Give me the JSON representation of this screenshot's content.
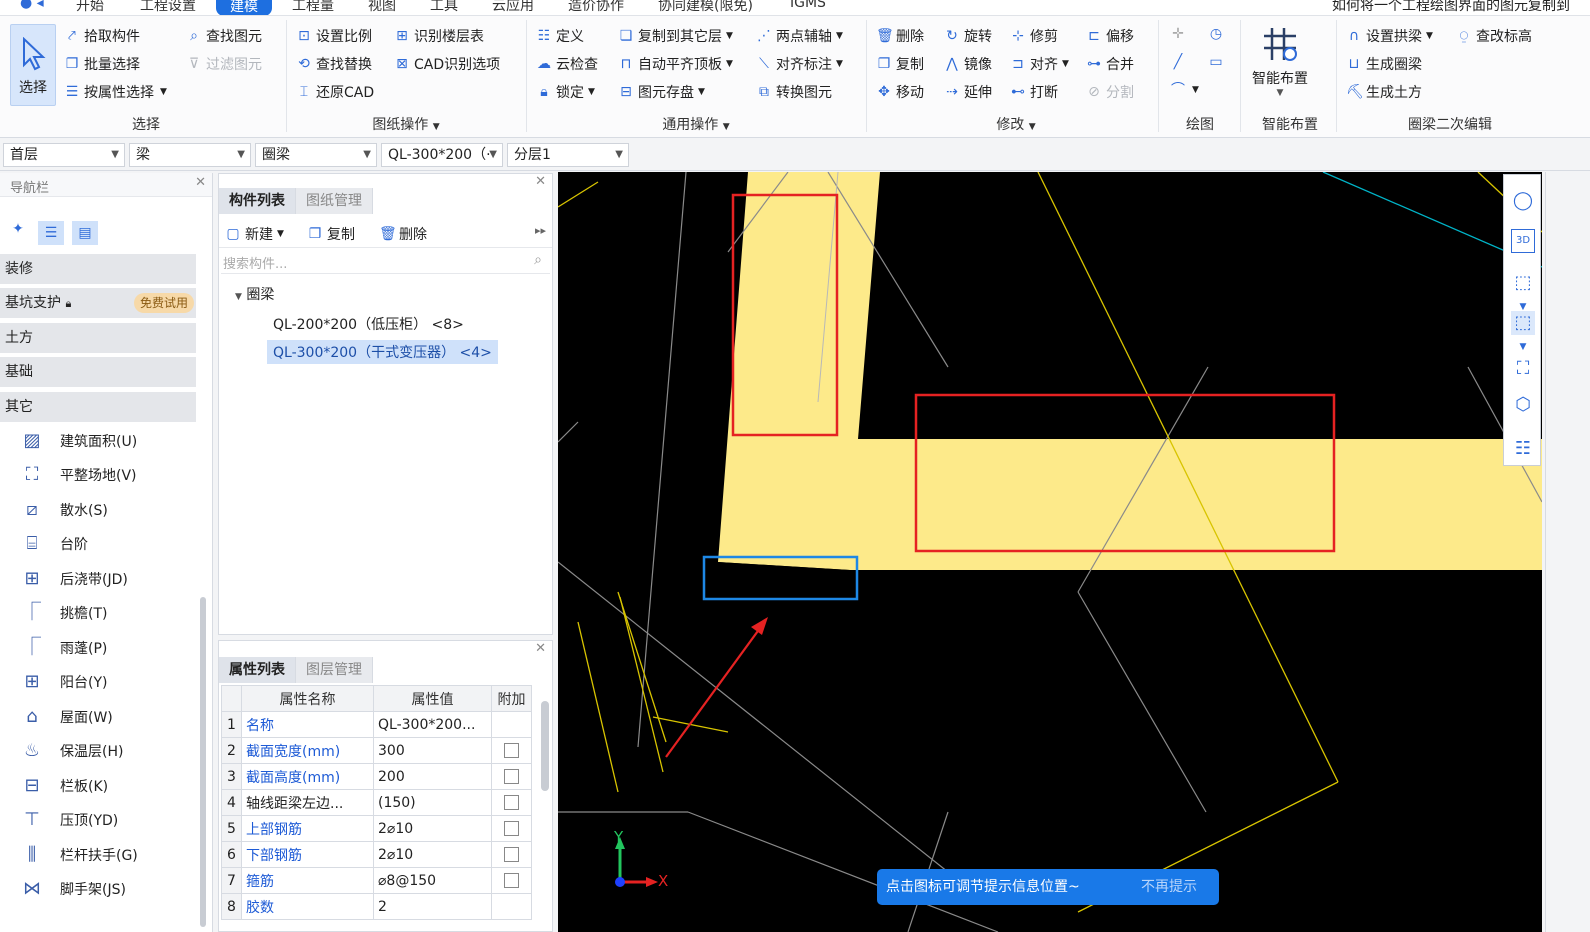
{
  "menu": {
    "items": [
      "开始",
      "工程设置",
      "建模",
      "工程量",
      "视图",
      "工具",
      "云应用",
      "造价协作",
      "协同建模(限免)",
      "IGMS"
    ],
    "active": "建模",
    "question": "如何将一个工程绘图界面的图元复制到"
  },
  "ribbon": {
    "select_big": "选择",
    "select_group": {
      "pick": "拾取构件",
      "batch": "批量选择",
      "byprop": "按属性选择",
      "find": "查找图元",
      "filter": "过滤图元",
      "label": "选择"
    },
    "drawing_group": {
      "scale": "设置比例",
      "identify_floor": "识别楼层表",
      "find_replace": "查找替换",
      "cad_options": "CAD识别选项",
      "restore": "还原CAD",
      "label": "图纸操作"
    },
    "common_group": {
      "define": "定义",
      "copy_to_layer": "复制到其它层",
      "two_point_axis": "两点辅轴",
      "cloud_check": "云检查",
      "auto_align": "自动平齐顶板",
      "align_mark": "对齐标注",
      "lock": "锁定",
      "element_store": "图元存盘",
      "convert": "转换图元",
      "label": "通用操作"
    },
    "modify_group": {
      "delete": "删除",
      "rotate": "旋转",
      "trim": "修剪",
      "offset": "偏移",
      "copy": "复制",
      "mirror": "镜像",
      "align": "对齐",
      "merge": "合并",
      "move": "移动",
      "extend": "延伸",
      "break": "打断",
      "split": "分割",
      "label": "修改"
    },
    "draw_label": "绘图",
    "smart": {
      "button": "智能布置",
      "label": "智能布置"
    },
    "ring_group": {
      "set_arch": "设置拱梁",
      "check_elev": "查改标高",
      "gen_ring": "生成圈梁",
      "gen_earth": "生成土方",
      "label": "圈梁二次编辑"
    }
  },
  "combos": {
    "floor": "首层",
    "type": "梁",
    "subtype": "圈梁",
    "element": "QL-300*200（·",
    "layer": "分层1"
  },
  "nav": {
    "title": "导航栏",
    "categories": [
      "装修",
      "基坑支护",
      "土方",
      "基础",
      "其它"
    ],
    "trial_badge": "免费试用",
    "items": [
      "建筑面积(U)",
      "平整场地(V)",
      "散水(S)",
      "台阶",
      "后浇带(JD)",
      "挑檐(T)",
      "雨蓬(P)",
      "阳台(Y)",
      "屋面(W)",
      "保温层(H)",
      "栏板(K)",
      "压顶(YD)",
      "栏杆扶手(G)",
      "脚手架(JS)"
    ]
  },
  "component_panel": {
    "tabs": [
      "构件列表",
      "图纸管理"
    ],
    "new": "新建",
    "copy": "复制",
    "delete": "删除",
    "search_placeholder": "搜索构件...",
    "tree_root": "圈梁",
    "tree_items": [
      "QL-200*200（低压柜）  <8>",
      "QL-300*200（干式变压器）  <4>"
    ]
  },
  "property_panel": {
    "tabs": [
      "属性列表",
      "图层管理"
    ],
    "headers": [
      "属性名称",
      "属性值",
      "附加"
    ],
    "rows": [
      {
        "n": "1",
        "name": "名称",
        "value": "QL-300*200..."
      },
      {
        "n": "2",
        "name": "截面宽度(mm)",
        "value": "300"
      },
      {
        "n": "3",
        "name": "截面高度(mm)",
        "value": "200"
      },
      {
        "n": "4",
        "name": "轴线距梁左边...",
        "value": "(150)"
      },
      {
        "n": "5",
        "name": "上部钢筋",
        "value": "2⌀10"
      },
      {
        "n": "6",
        "name": "下部钢筋",
        "value": "2⌀10"
      },
      {
        "n": "7",
        "name": "箍筋",
        "value": "⌀8@150"
      },
      {
        "n": "8",
        "name": "胶数",
        "value": "2"
      }
    ]
  },
  "canvas": {
    "tip_text": "点击图标可调节提示信息位置~",
    "tip_dismiss": "不再提示",
    "axis_y": "Y",
    "axis_x": "X",
    "beam_color": "#fdea8a",
    "highlight_red": "#e52222",
    "highlight_blue": "#1e88e5"
  }
}
